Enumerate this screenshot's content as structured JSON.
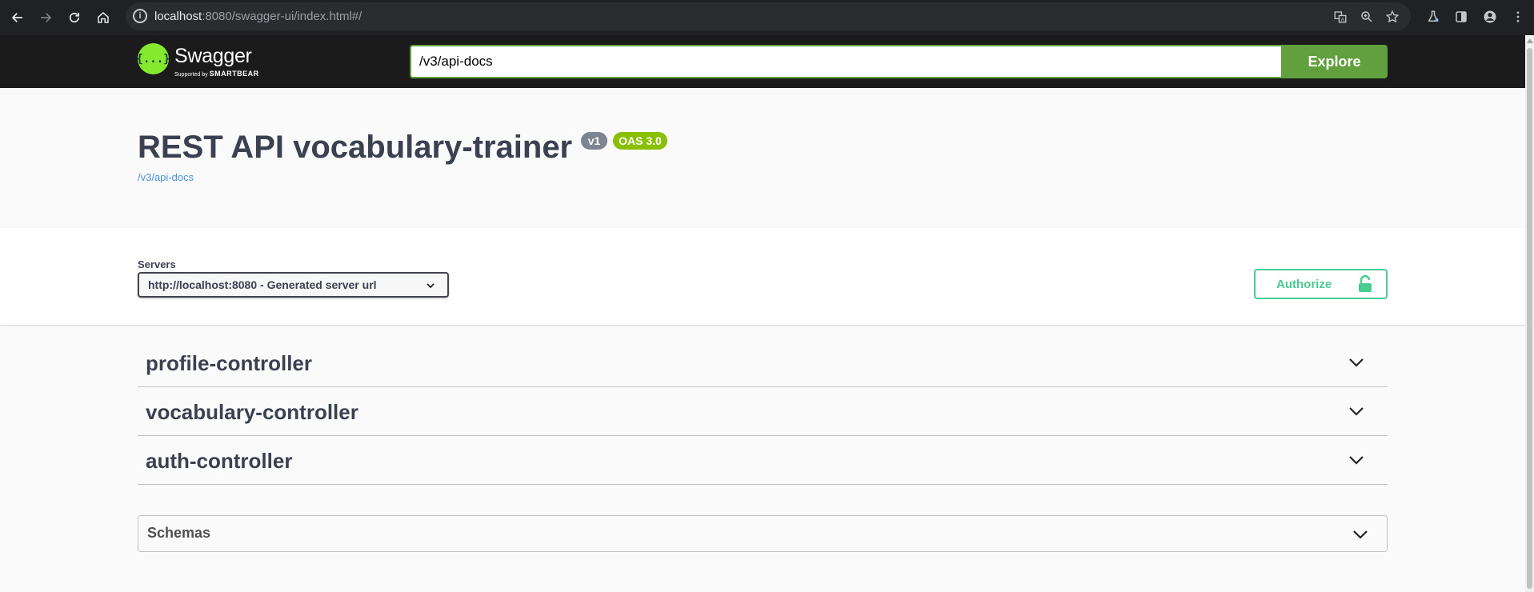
{
  "browser": {
    "url_host": "localhost",
    "url_path": ":8080/swagger-ui/index.html#/"
  },
  "topbar": {
    "logo_text": "Swagger",
    "logo_glyph": "{...}",
    "logo_sub_prefix": "Supported by",
    "logo_sub_brand": "SMARTBEAR",
    "url_value": "/v3/api-docs",
    "explore_label": "Explore",
    "accent": "#62a03f"
  },
  "info": {
    "title": "REST API vocabulary-trainer",
    "version": "v1",
    "oas": "OAS 3.0",
    "spec_link": "/v3/api-docs"
  },
  "servers": {
    "label": "Servers",
    "selected": "http://localhost:8080 - Generated server url",
    "authorize_label": "Authorize"
  },
  "tags": [
    {
      "name": "profile-controller"
    },
    {
      "name": "vocabulary-controller"
    },
    {
      "name": "auth-controller"
    }
  ],
  "schemas": {
    "title": "Schemas"
  },
  "colors": {
    "authorize": "#49cc90",
    "text": "#3b4151",
    "link": "#4990e2"
  }
}
